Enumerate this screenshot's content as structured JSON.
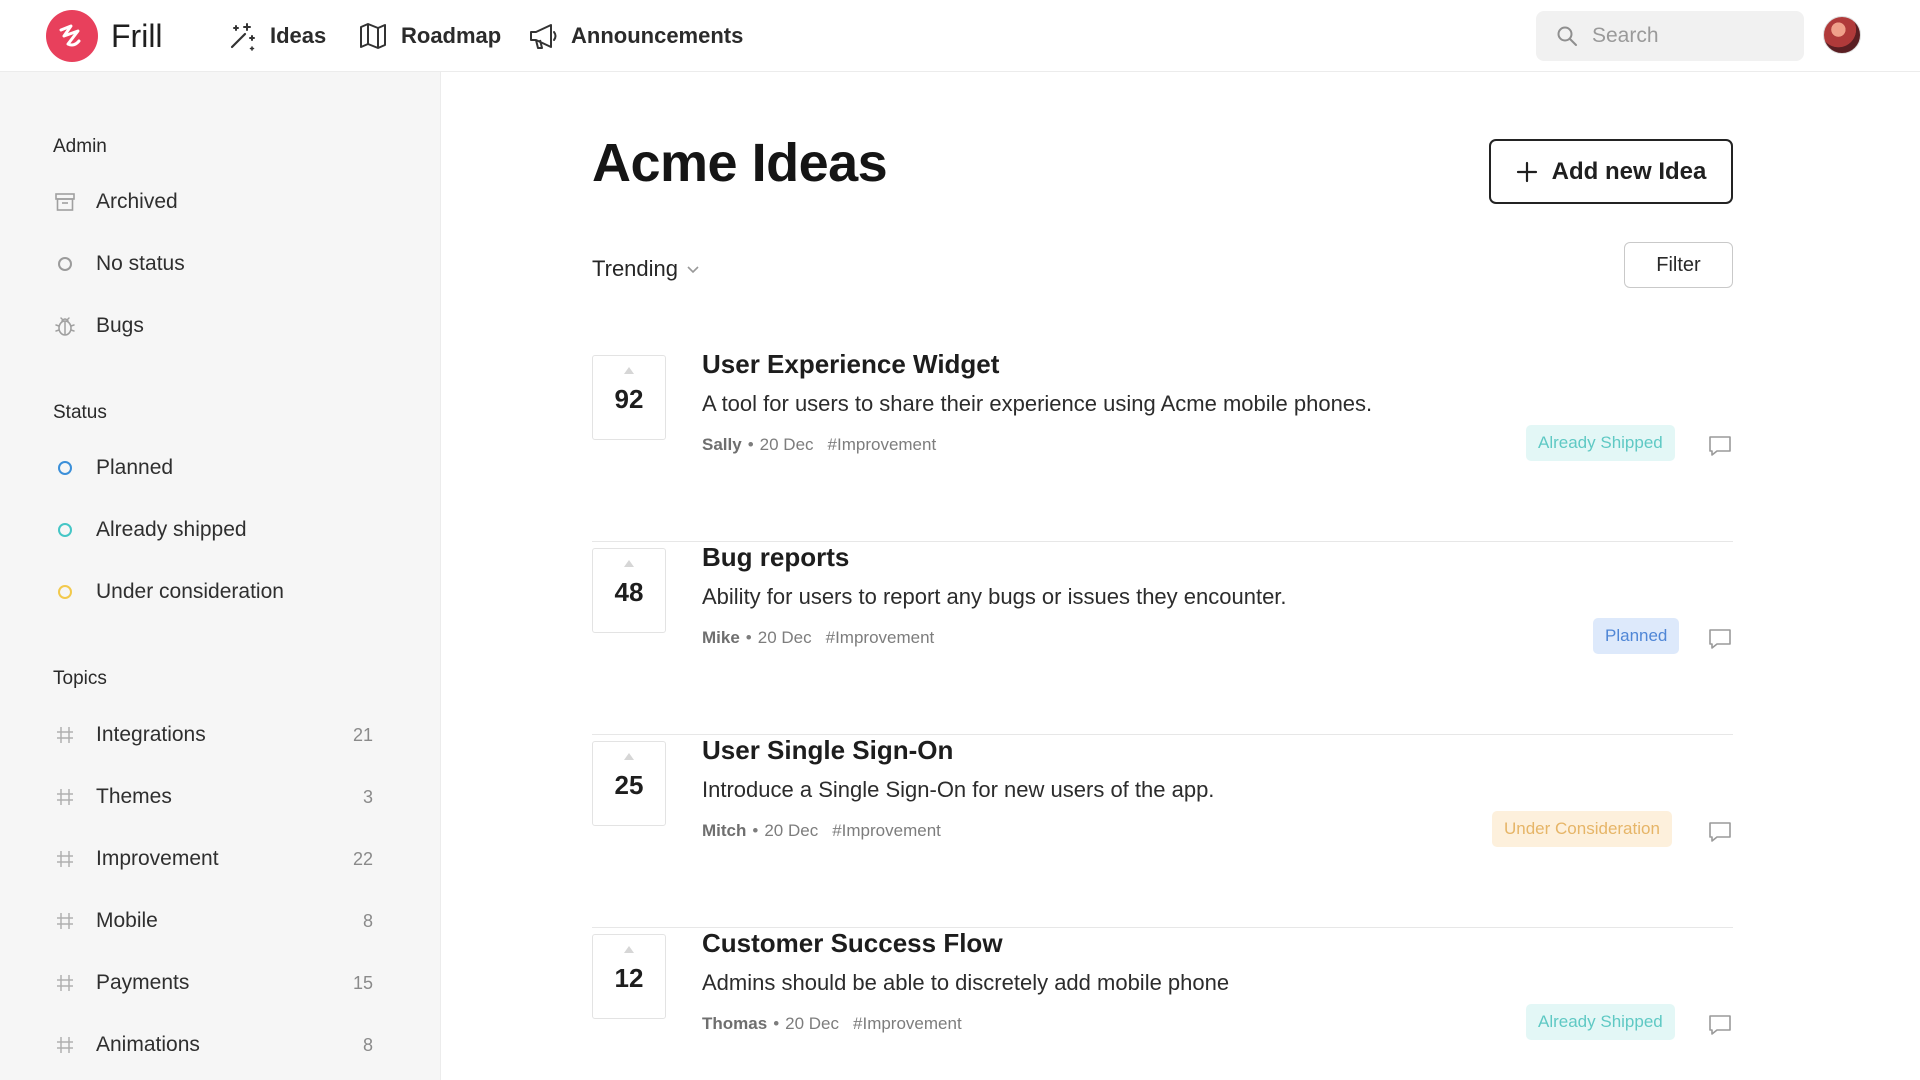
{
  "brand": {
    "name": "Frill",
    "color": "#e8405c"
  },
  "nav": [
    {
      "label": "Ideas",
      "icon": "sparkles-icon"
    },
    {
      "label": "Roadmap",
      "icon": "map-icon"
    },
    {
      "label": "Announcements",
      "icon": "megaphone-icon"
    }
  ],
  "search": {
    "placeholder": "Search"
  },
  "sidebar": {
    "admin": {
      "title": "Admin",
      "items": [
        {
          "label": "Archived",
          "icon": "archive-icon"
        },
        {
          "label": "No status",
          "icon": "circle-icon"
        },
        {
          "label": "Bugs",
          "icon": "bug-icon"
        }
      ]
    },
    "status": {
      "title": "Status",
      "items": [
        {
          "label": "Planned",
          "color": "#3b8fd9"
        },
        {
          "label": "Already shipped",
          "color": "#45c6c6"
        },
        {
          "label": "Under consideration",
          "color": "#f2c94c"
        }
      ]
    },
    "topics": {
      "title": "Topics",
      "items": [
        {
          "label": "Integrations",
          "count": "21"
        },
        {
          "label": "Themes",
          "count": "3"
        },
        {
          "label": "Improvement",
          "count": "22"
        },
        {
          "label": "Mobile",
          "count": "8"
        },
        {
          "label": "Payments",
          "count": "15"
        },
        {
          "label": "Animations",
          "count": "8"
        }
      ]
    }
  },
  "main": {
    "title": "Acme Ideas",
    "add_label": "Add new Idea",
    "sort_label": "Trending",
    "filter_label": "Filter",
    "ideas": [
      {
        "votes": "92",
        "title": "User Experience Widget",
        "description": "A tool for users to share their experience using Acme mobile phones.",
        "author": "Sally",
        "date": "20 Dec",
        "tag": "#Improvement",
        "status": "Already Shipped",
        "status_bg": "#e3f7f6",
        "status_fg": "#5fc9c4"
      },
      {
        "votes": "48",
        "title": "Bug reports",
        "description": "Ability for users to report any bugs or issues they encounter.",
        "author": "Mike",
        "date": "20 Dec",
        "tag": "#Improvement",
        "status": "Planned",
        "status_bg": "#dde9fb",
        "status_fg": "#4f86d6"
      },
      {
        "votes": "25",
        "title": "User Single Sign-On",
        "description": "Introduce a Single Sign-On for new users of the app.",
        "author": "Mitch",
        "date": "20 Dec",
        "tag": "#Improvement",
        "status": "Under Consideration",
        "status_bg": "#fdf0dc",
        "status_fg": "#e6b567"
      },
      {
        "votes": "12",
        "title": "Customer Success Flow",
        "description": "Admins should be able to discretely add mobile phone",
        "author": "Thomas",
        "date": "20 Dec",
        "tag": "#Improvement",
        "status": "Already Shipped",
        "status_bg": "#e3f7f6",
        "status_fg": "#5fc9c4"
      }
    ]
  }
}
